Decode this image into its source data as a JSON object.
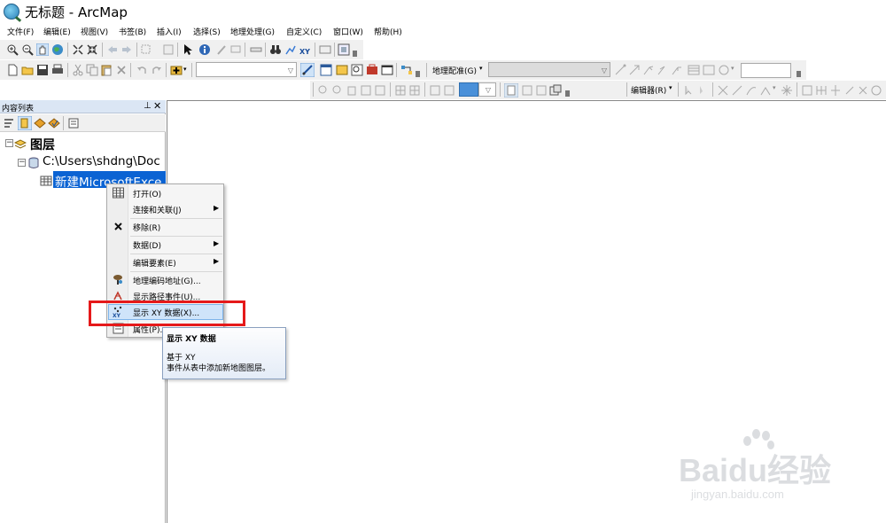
{
  "window": {
    "title": "无标题 - ArcMap"
  },
  "menubar": [
    "文件(F)",
    "编辑(E)",
    "视图(V)",
    "书签(B)",
    "插入(I)",
    "选择(S)",
    "地理处理(G)",
    "自定义(C)",
    "窗口(W)",
    "帮助(H)"
  ],
  "toolbars": {
    "georeferencing_label": "地理配准(G)",
    "editor_label": "编辑器(R)",
    "scale_value": "",
    "layer_combo_value": "",
    "georef_layer_value": ""
  },
  "toc": {
    "title": "内容列表",
    "root_label": "图层",
    "folder_label": "C:\\Users\\shdng\\Doc",
    "table_label": "新建MicrosoftExce"
  },
  "context_menu": {
    "items": [
      {
        "label": "打开(O)",
        "icon": "table-icon",
        "submenu": false
      },
      {
        "label": "连接和关联(J)",
        "icon": "",
        "submenu": true
      },
      {
        "label": "移除(R)",
        "icon": "remove-x-icon",
        "submenu": false
      },
      {
        "label": "数据(D)",
        "icon": "",
        "submenu": true
      },
      {
        "label": "编辑要素(E)",
        "icon": "",
        "submenu": true
      },
      {
        "label": "地理编码地址(G)...",
        "icon": "geocode-icon",
        "submenu": false
      },
      {
        "label": "显示路径事件(U)...",
        "icon": "route-event-icon",
        "submenu": false
      },
      {
        "label": "显示 XY 数据(X)...",
        "icon": "display-xy-icon",
        "submenu": false,
        "highlighted": true
      },
      {
        "label": "属性(P)...",
        "icon": "properties-icon",
        "submenu": false
      }
    ]
  },
  "tooltip": {
    "title": "显示 XY 数据",
    "line1": "基于 XY",
    "line2": "事件从表中添加新地图图层。"
  },
  "highlight_color": "#e5191a",
  "watermark": {
    "text": "Baidu经验",
    "sub": "jingyan.baidu.com"
  }
}
